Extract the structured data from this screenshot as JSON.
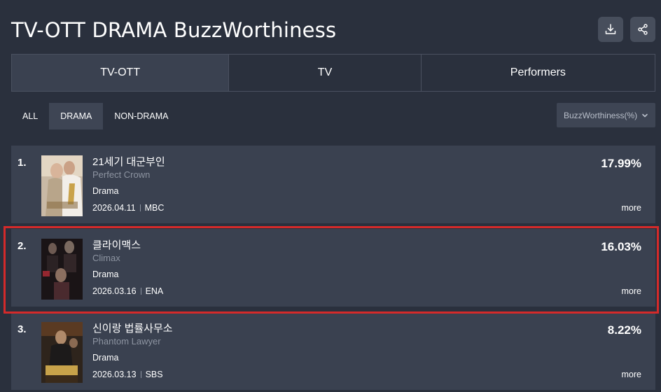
{
  "header": {
    "title": "TV-OTT DRAMA BuzzWorthiness",
    "download_icon": "download-icon",
    "share_icon": "share-icon"
  },
  "tabs": [
    {
      "label": "TV-OTT",
      "active": true
    },
    {
      "label": "TV",
      "active": false
    },
    {
      "label": "Performers",
      "active": false
    }
  ],
  "filters": [
    {
      "label": "ALL",
      "active": false
    },
    {
      "label": "DRAMA",
      "active": true
    },
    {
      "label": "NON-DRAMA",
      "active": false
    }
  ],
  "sort": {
    "label": "BuzzWorthiness(%)",
    "icon": "chevron-down-icon"
  },
  "rankings": [
    {
      "rank": "1.",
      "title_ko": "21세기 대군부인",
      "title_en": "Perfect Crown",
      "genre": "Drama",
      "date": "2026.04.11",
      "network": "MBC",
      "percent": "17.99%",
      "more": "more"
    },
    {
      "rank": "2.",
      "title_ko": "클라이맥스",
      "title_en": "Climax",
      "genre": "Drama",
      "date": "2026.03.16",
      "network": "ENA",
      "percent": "16.03%",
      "more": "more"
    },
    {
      "rank": "3.",
      "title_ko": "신이랑 법률사무소",
      "title_en": "Phantom Lawyer",
      "genre": "Drama",
      "date": "2026.03.13",
      "network": "SBS",
      "percent": "8.22%",
      "more": "more"
    }
  ],
  "colors": {
    "background": "#2a303d",
    "card": "#3a4150",
    "highlight": "#d42a2a"
  }
}
